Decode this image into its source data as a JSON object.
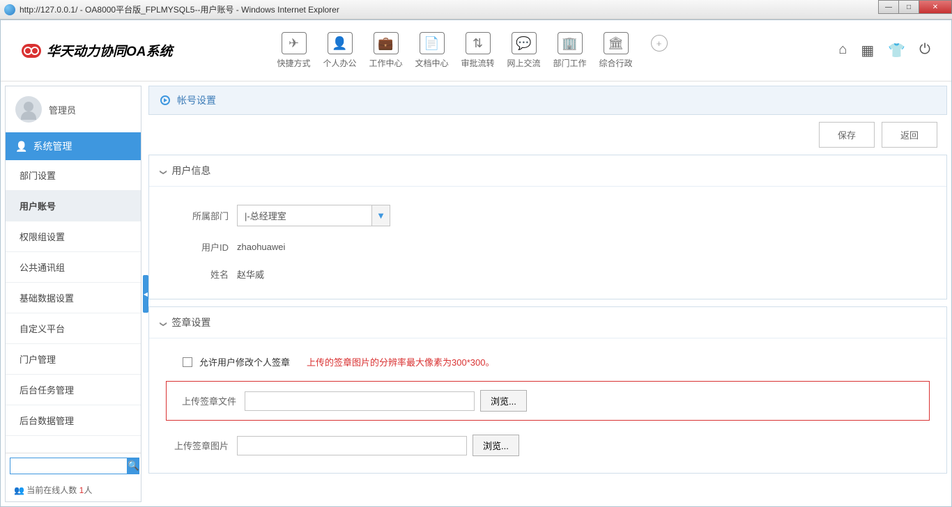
{
  "window": {
    "title": "http://127.0.0.1/ - OA8000平台版_FPLMYSQL5--用户账号 - Windows Internet Explorer"
  },
  "logo_text": "华天动力协同OA系统",
  "nav": [
    {
      "label": "快捷方式",
      "icon": "✈"
    },
    {
      "label": "个人办公",
      "icon": "👤"
    },
    {
      "label": "工作中心",
      "icon": "💼"
    },
    {
      "label": "文档中心",
      "icon": "📄"
    },
    {
      "label": "审批流转",
      "icon": "⇅"
    },
    {
      "label": "网上交流",
      "icon": "💬"
    },
    {
      "label": "部门工作",
      "icon": "🏢"
    },
    {
      "label": "综合行政",
      "icon": "🏛"
    }
  ],
  "sidebar": {
    "user_name": "管理员",
    "category": "系统管理",
    "menu": [
      "部门设置",
      "用户账号",
      "权限组设置",
      "公共通讯组",
      "基础数据设置",
      "自定义平台",
      "门户管理",
      "后台任务管理",
      "后台数据管理"
    ],
    "active_index": 1,
    "online_prefix": "当前在线人数 ",
    "online_count": "1",
    "online_suffix": "人"
  },
  "breadcrumb": "帐号设置",
  "actions": {
    "save": "保存",
    "back": "返回"
  },
  "panel_user": {
    "title": "用户信息",
    "dept_label": "所属部门",
    "dept_value": "|-总经理室",
    "id_label": "用户ID",
    "id_value": "zhaohuawei",
    "name_label": "姓名",
    "name_value": "赵华威"
  },
  "panel_sign": {
    "title": "签章设置",
    "checkbox_label": "允许用户修改个人签章",
    "warn": "上传的签章图片的分辨率最大像素为300*300。",
    "upload_file_label": "上传签章文件",
    "upload_img_label": "上传签章图片",
    "browse": "浏览..."
  }
}
